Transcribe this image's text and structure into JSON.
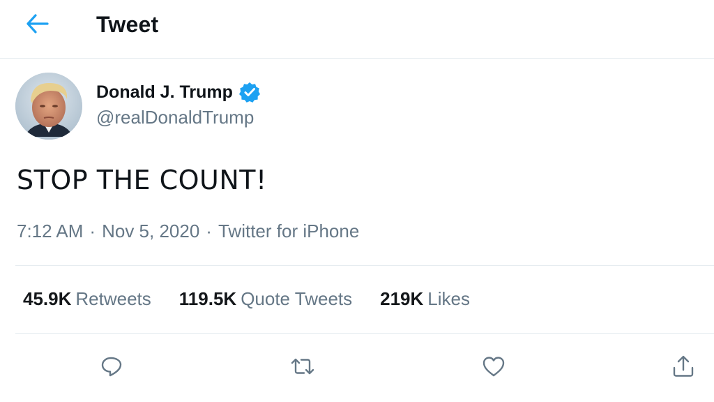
{
  "header": {
    "title": "Tweet",
    "back_icon": "arrow-left-icon",
    "accent_color": "#1da1f2"
  },
  "tweet": {
    "author": {
      "name": "Donald J. Trump",
      "handle": "@realDonaldTrump",
      "verified": true,
      "verified_icon": "verified-badge-icon"
    },
    "text": "STOP THE COUNT!",
    "time": "7:12 AM",
    "date": "Nov 5, 2020",
    "source": "Twitter for iPhone",
    "separator": "·"
  },
  "stats": {
    "retweets": {
      "count": "45.9K",
      "label": "Retweets"
    },
    "quote_tweets": {
      "count": "119.5K",
      "label": "Quote Tweets"
    },
    "likes": {
      "count": "219K",
      "label": "Likes"
    }
  },
  "actions": [
    {
      "name": "reply",
      "icon": "reply-icon"
    },
    {
      "name": "retweet",
      "icon": "retweet-icon"
    },
    {
      "name": "like",
      "icon": "heart-icon"
    },
    {
      "name": "share",
      "icon": "share-icon"
    }
  ],
  "colors": {
    "text_primary": "#0f1419",
    "text_secondary": "#657786",
    "border": "#e6ecf0",
    "accent": "#1da1f2"
  }
}
